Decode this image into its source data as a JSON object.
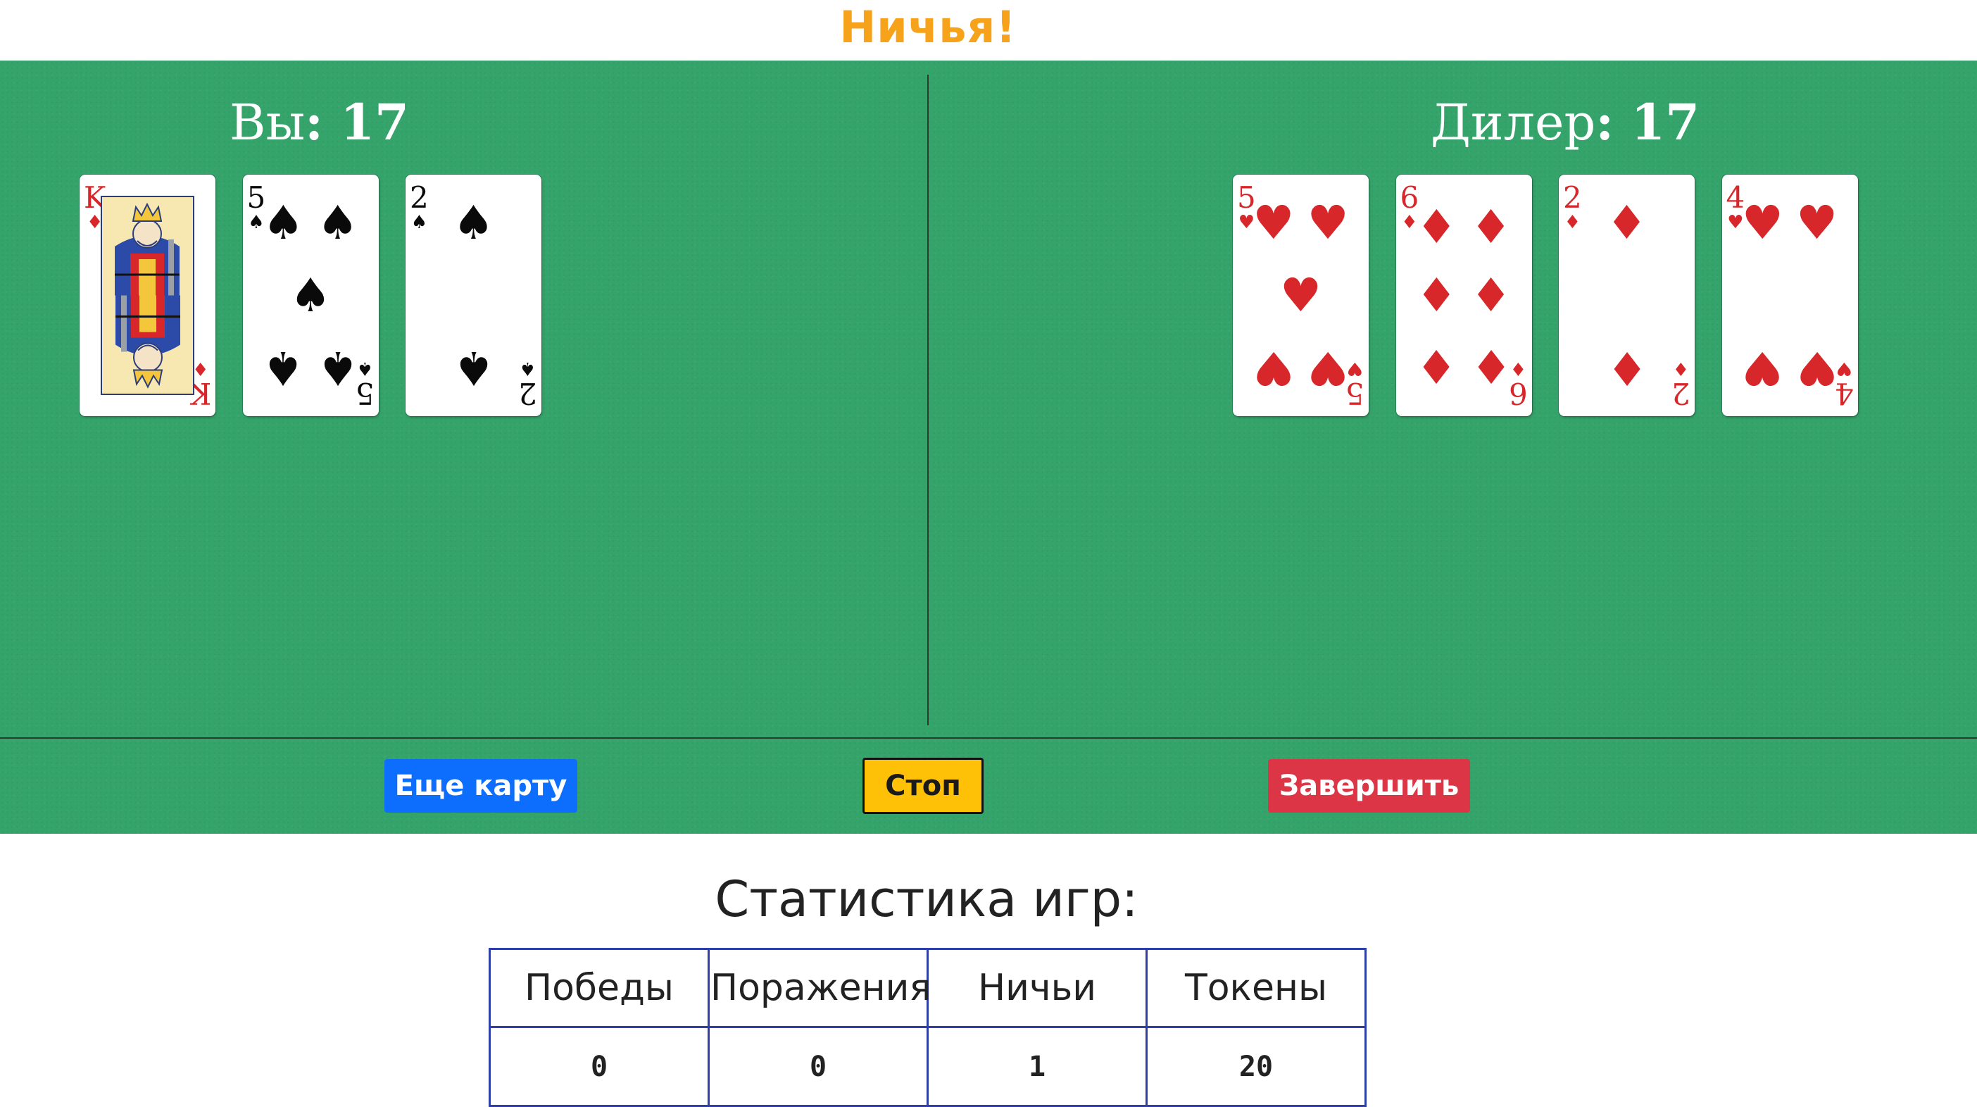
{
  "status": {
    "result": "Ничья!"
  },
  "player": {
    "label": "Вы",
    "score": "17",
    "cards": [
      {
        "rank": "K",
        "suit": "diamonds",
        "glyph": "♦",
        "color": "red"
      },
      {
        "rank": "5",
        "suit": "spades",
        "glyph": "♠",
        "color": "black"
      },
      {
        "rank": "2",
        "suit": "spades",
        "glyph": "♠",
        "color": "black"
      }
    ]
  },
  "dealer": {
    "label": "Дилер",
    "score": "17",
    "cards": [
      {
        "rank": "5",
        "suit": "hearts",
        "glyph": "♥",
        "color": "red"
      },
      {
        "rank": "6",
        "suit": "diamonds",
        "glyph": "♦",
        "color": "red"
      },
      {
        "rank": "2",
        "suit": "diamonds",
        "glyph": "♦",
        "color": "red"
      },
      {
        "rank": "4",
        "suit": "hearts",
        "glyph": "♥",
        "color": "red"
      }
    ]
  },
  "controls": {
    "hit_label": "Еще карту",
    "stand_label": "Стоп",
    "end_label": "Завершить"
  },
  "stats": {
    "title": "Статистика игр:",
    "headers": [
      "Победы",
      "Поражения",
      "Ничьи",
      "Токены"
    ],
    "values": [
      "0",
      "0",
      "1",
      "20"
    ]
  },
  "colors": {
    "felt": "#35a46b",
    "result": "#f6a21a",
    "hit": "#0d6efd",
    "stand": "#ffc107",
    "end": "#dc3545",
    "table_border": "#2f3fa8"
  }
}
